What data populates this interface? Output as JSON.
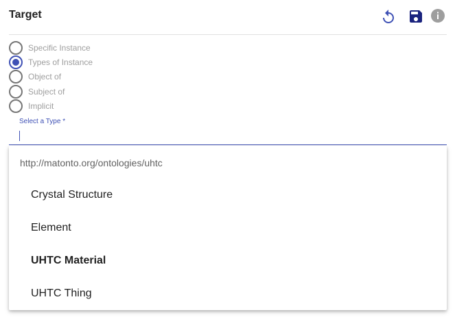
{
  "header": {
    "title": "Target",
    "icons": {
      "refresh": "refresh-icon",
      "save": "save-icon",
      "info": "info-icon"
    },
    "colors": {
      "accent": "#3f51b5",
      "save": "#1a237e",
      "info": "#9e9e9e"
    }
  },
  "target_types": [
    {
      "label": "Specific Instance",
      "checked": false
    },
    {
      "label": "Types of Instance",
      "checked": true
    },
    {
      "label": "Object of",
      "checked": false
    },
    {
      "label": "Subject of",
      "checked": false
    },
    {
      "label": "Implicit",
      "checked": false
    }
  ],
  "type_select": {
    "label": "Select a Type *",
    "value": ""
  },
  "dropdown": {
    "group": "http://matonto.org/ontologies/uhtc",
    "options": [
      {
        "label": "Crystal Structure",
        "bold": false
      },
      {
        "label": "Element",
        "bold": false
      },
      {
        "label": "UHTC Material",
        "bold": true
      },
      {
        "label": "UHTC Thing",
        "bold": false
      }
    ]
  }
}
